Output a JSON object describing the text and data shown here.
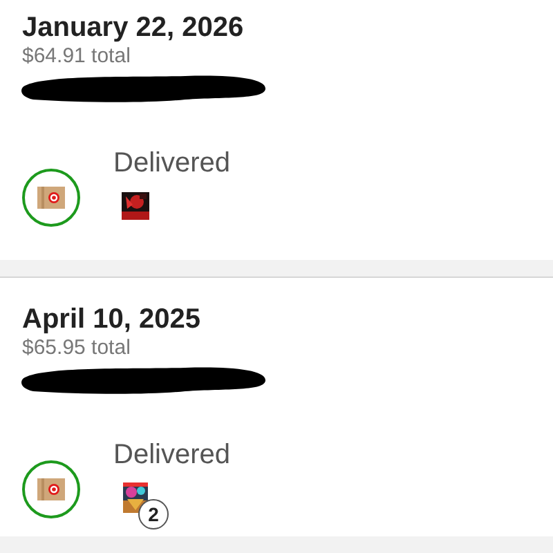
{
  "orders": [
    {
      "date": "January 22, 2026",
      "total": "$64.91 total",
      "status": "Delivered"
    },
    {
      "date": "April 10, 2025",
      "total": "$65.95 total",
      "status": "Delivered",
      "item_count": "2"
    }
  ]
}
